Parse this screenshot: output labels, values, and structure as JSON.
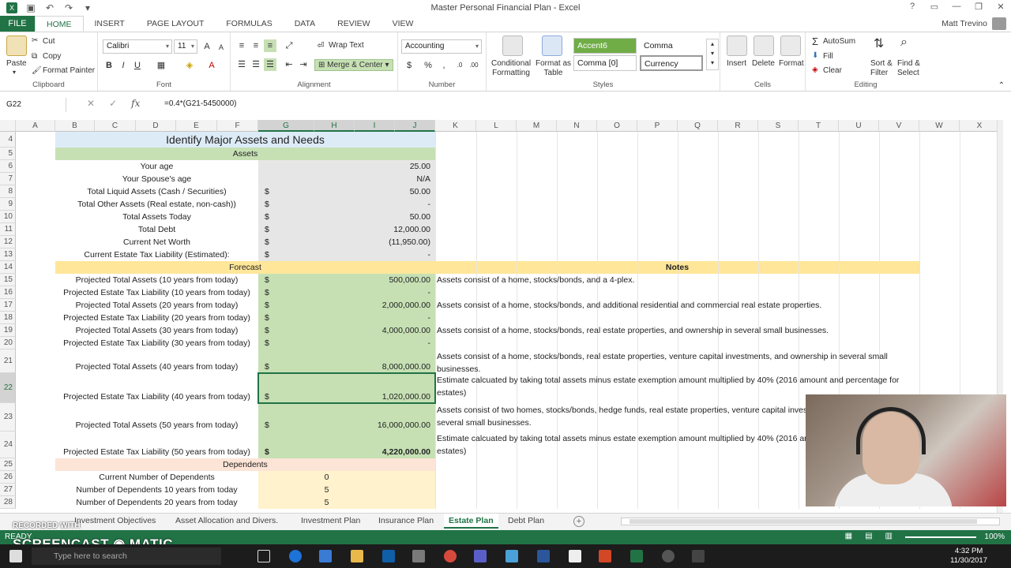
{
  "window": {
    "title": "Master Personal Financial Plan - Excel",
    "user": "Matt Trevino"
  },
  "menu": {
    "file": "FILE",
    "tabs": [
      "HOME",
      "INSERT",
      "PAGE LAYOUT",
      "FORMULAS",
      "DATA",
      "REVIEW",
      "VIEW"
    ]
  },
  "ribbon": {
    "clipboard": {
      "paste": "Paste",
      "cut": "Cut",
      "copy": "Copy",
      "format_painter": "Format Painter",
      "label": "Clipboard"
    },
    "font": {
      "name": "Calibri",
      "size": "11",
      "label": "Font"
    },
    "alignment": {
      "wrap_text": "Wrap Text",
      "merge_center": "Merge & Center",
      "label": "Alignment"
    },
    "number": {
      "format": "Accounting",
      "label": "Number",
      "currency_symbol": "$",
      "percent_symbol": "%"
    },
    "styles": {
      "conditional": "Conditional",
      "formatting": "Formatting",
      "format_as": "Format as",
      "table": "Table",
      "accent": "Accent6",
      "comma": "Comma",
      "comma0": "Comma [0]",
      "currency": "Currency",
      "label": "Styles"
    },
    "cells": {
      "insert": "Insert",
      "delete": "Delete",
      "format": "Format",
      "label": "Cells"
    },
    "editing": {
      "autosum": "AutoSum",
      "fill": "Fill",
      "clear": "Clear",
      "sort": "Sort &",
      "filter": "Filter",
      "find": "Find &",
      "select": "Select",
      "label": "Editing"
    }
  },
  "formula_bar": {
    "name_box": "G22",
    "formula": "=0.4*(G21-5450000)",
    "fx": "fx"
  },
  "columns": [
    "A",
    "B",
    "C",
    "D",
    "E",
    "F",
    "G",
    "H",
    "I",
    "J",
    "K",
    "L",
    "M",
    "N",
    "O",
    "P",
    "Q",
    "R",
    "S",
    "T",
    "U",
    "V",
    "W",
    "X"
  ],
  "rows": {
    "numbers": [
      "4",
      "5",
      "6",
      "7",
      "8",
      "9",
      "10",
      "11",
      "12",
      "13",
      "14",
      "15",
      "16",
      "17",
      "18",
      "19",
      "20",
      "21",
      "22",
      "23",
      "24",
      "25",
      "26",
      "27",
      "28"
    ]
  },
  "sheet": {
    "title": "Identify Major Assets and Needs",
    "assets_header": "Assets",
    "forecast_header": "Forecast",
    "notes_header": "Notes",
    "dependents_header": "Dependents",
    "assets": [
      {
        "label": "Your age",
        "dollar": "",
        "value": "25.00"
      },
      {
        "label": "Your Spouse's age",
        "dollar": "",
        "value": "N/A"
      },
      {
        "label": "Total Liquid Assets  (Cash / Securities)",
        "dollar": "$",
        "value": "50.00"
      },
      {
        "label": "Total Other Assets (Real estate, non-cash))",
        "dollar": "$",
        "value": "-"
      },
      {
        "label": "Total Assets Today",
        "dollar": "$",
        "value": "50.00"
      },
      {
        "label": "Total Debt",
        "dollar": "$",
        "value": "12,000.00"
      },
      {
        "label": "Current Net Worth",
        "dollar": "$",
        "value": "(11,950.00)"
      },
      {
        "label": "Current Estate Tax Liability (Estimated):",
        "dollar": "$",
        "value": "-"
      }
    ],
    "forecast": [
      {
        "label": "Projected Total Assets (10 years from today)",
        "dollar": "$",
        "value": "500,000.00",
        "note": "Assets consist of a home, stocks/bonds, and a 4-plex."
      },
      {
        "label": "Projected Estate Tax Liability (10 years from today)",
        "dollar": "$",
        "value": "-",
        "note": ""
      },
      {
        "label": "Projected Total Assets (20 years from today)",
        "dollar": "$",
        "value": "2,000,000.00",
        "note": "Assets consist of a home, stocks/bonds, and additional residential and commercial real estate properties."
      },
      {
        "label": "Projected Estate Tax Liability (20 years from today)",
        "dollar": "$",
        "value": "-",
        "note": ""
      },
      {
        "label": "Projected Total Assets (30 years from today)",
        "dollar": "$",
        "value": "4,000,000.00",
        "note": "Assets consist of a home, stocks/bonds, real estate properties, and ownership in several small businesses."
      },
      {
        "label": "Projected Estate Tax Liability (30 years from today)",
        "dollar": "$",
        "value": "-",
        "note": ""
      },
      {
        "label": "Projected Total Assets (40 years from today)",
        "dollar": "$",
        "value": "8,000,000.00",
        "note": "Assets consist of a home, stocks/bonds, real estate properties, venture capital investments, and ownership in several small businesses."
      },
      {
        "label": "Projected Estate Tax Liability (40 years from today)",
        "dollar": "$",
        "value": "1,020,000.00",
        "note": "Estimate calcuated by taking total assets minus estate exemption amount multiplied by 40% (2016 amount and percentage for estates)"
      },
      {
        "label": "Projected Total Assets (50 years from today)",
        "dollar": "$",
        "value": "16,000,000.00",
        "note": "Assets consist of two homes, stocks/bonds, hedge funds, real estate properties, venture capital investments, and ownership in several small businesses."
      },
      {
        "label": "Projected Estate Tax Liability (50 years from today)",
        "dollar": "$",
        "value": "4,220,000.00",
        "note": "Estimate calcuated by taking total assets minus estate exemption amount multiplied by 40% (2016 amount and percentage for estates)"
      }
    ],
    "dependents": [
      {
        "label": "Current Number of Dependents",
        "value": "0"
      },
      {
        "label": "Number of Dependents 10 years from today",
        "value": "5"
      },
      {
        "label": "Number of Dependents 20 years from today",
        "value": "5"
      }
    ]
  },
  "sheet_tabs": {
    "tabs": [
      "Investment Objectives",
      "Asset Allocation and Divers.",
      "Investment Plan",
      "Insurance Plan",
      "Estate Plan",
      "Debt Plan"
    ],
    "active": "Estate Plan",
    "add": "+"
  },
  "status": {
    "ready": "READY",
    "zoom": "100%"
  },
  "watermark": {
    "top": "RECORDED WITH",
    "brand": "SCREENCAST ◉ MATIC"
  },
  "taskbar": {
    "search_placeholder": "Type here to search",
    "time": "4:32 PM",
    "date": "11/30/2017"
  },
  "colors": {
    "excel_green": "#217346",
    "assets_green": "#c6e0b4",
    "header_yellow": "#ffe699",
    "dependents_peach": "#fce4d6",
    "title_blue": "#ddebf7",
    "values_gray": "#e7e6e6"
  }
}
